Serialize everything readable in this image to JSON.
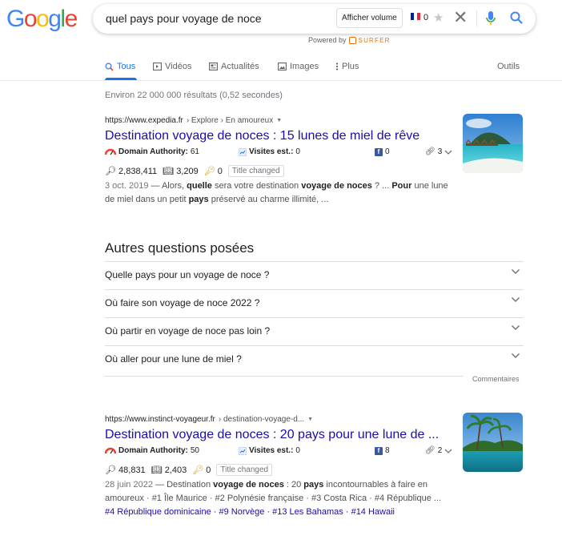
{
  "logo": {
    "letters": [
      "G",
      "o",
      "o",
      "g",
      "l",
      "e"
    ],
    "colors": [
      "#4285F4",
      "#EA4335",
      "#FBBC05",
      "#4285F4",
      "#34A853",
      "#EA4335"
    ]
  },
  "search": {
    "query": "quel pays pour voyage de noce",
    "volume_button": "Afficher volume",
    "volume_count": "0",
    "powered_by": "Powered by",
    "surfer": "SURFER"
  },
  "tabs": [
    {
      "label": "Tous",
      "icon": "search-icon",
      "active": true
    },
    {
      "label": "Vidéos",
      "icon": "video-icon"
    },
    {
      "label": "Actualités",
      "icon": "news-icon"
    },
    {
      "label": "Images",
      "icon": "image-icon"
    },
    {
      "label": "Plus",
      "icon": "more-icon"
    }
  ],
  "tools": "Outils",
  "stats": "Environ 22 000 000 résultats (0,52 secondes)",
  "results": [
    {
      "domain": "https://www.expedia.fr",
      "path": "› Explore › En amoureux",
      "title": "Destination voyage de noces : 15 lunes de miel de rêve",
      "da_label": "Domain Authority:",
      "da_value": "61",
      "visits_label": "Visites est.:",
      "visits_value": "0",
      "fb_count": "0",
      "link_count": "3",
      "m1": "2,838,411",
      "m2": "3,209",
      "m3": "0",
      "tag": "Title changed",
      "date": "3 oct. 2019",
      "snippet_html": " — Alors, <b>quelle</b> sera votre destination <b>voyage de noces</b> ? ... <b>Pour</b> une lune de miel dans un petit <b>pays</b> préservé au charme illimité, ..."
    },
    {
      "domain": "https://www.instinct-voyageur.fr",
      "path": "› destination-voyage-d...",
      "title": "Destination voyage de noces : 20 pays pour une lune de ...",
      "da_label": "Domain Authority:",
      "da_value": "50",
      "visits_label": "Visites est.:",
      "visits_value": "0",
      "fb_count": "8",
      "link_count": "2",
      "m1": "48,831",
      "m2": "2,403",
      "m3": "0",
      "tag": "Title changed",
      "date": "28 juin 2022",
      "snippet_html": " — Destination <b>voyage de noces</b> : 20 <b>pays</b> incontournables à faire en amoureux · #1 Île Maurice · #2 Polynésie française · #3 Costa Rica · #4 République ...",
      "sitelinks": "#4 République dominicaine · #9 Norvège · #13 Les Bahamas · #14 Hawaii"
    }
  ],
  "paa": {
    "title": "Autres questions posées",
    "questions": [
      "Quelle pays pour un voyage de noce ?",
      "Où faire son voyage de noce 2022 ?",
      "Où partir en voyage de noce pas loin ?",
      "Où aller pour une lune de miel ?"
    ],
    "comments": "Commentaires"
  },
  "colors": {
    "link": "#1a0dab",
    "accent": "#1a73e8"
  }
}
